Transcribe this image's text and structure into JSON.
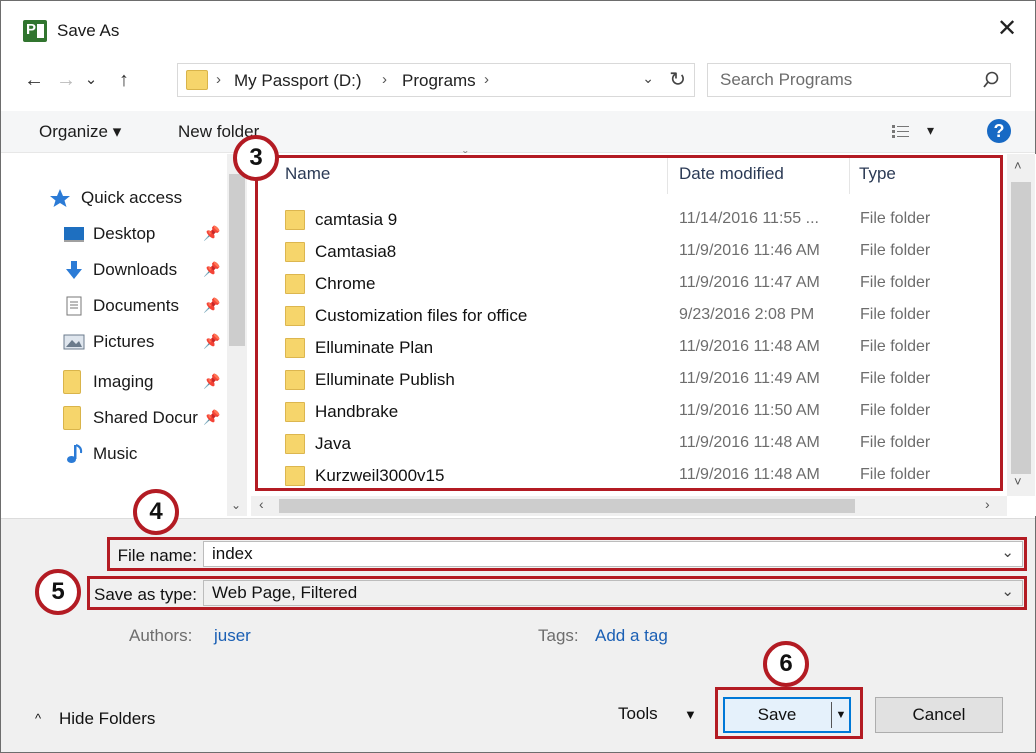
{
  "window": {
    "title": "Save As",
    "app_icon_letter": "P",
    "close_glyph": "✕"
  },
  "nav": {
    "back_glyph": "←",
    "forward_glyph": "→",
    "recent_glyph": "⌄",
    "up_glyph": "↑",
    "breadcrumbs": [
      "My Passport (D:)",
      "Programs"
    ],
    "breadcrumb_sep": "›",
    "dropdown_glyph": "⌄",
    "refresh_glyph": "↻",
    "search_placeholder": "Search Programs"
  },
  "toolbar": {
    "organize_label": "Organize ▾",
    "new_folder_label": "New folder",
    "view_dropdown_glyph": "▾",
    "help_label": "?"
  },
  "navpane": {
    "items": [
      {
        "label": "Quick access",
        "icon": "star-icon",
        "pinned": false
      },
      {
        "label": "Desktop",
        "icon": "desktop-icon",
        "pinned": true
      },
      {
        "label": "Downloads",
        "icon": "download-arrow-icon",
        "pinned": true
      },
      {
        "label": "Documents",
        "icon": "document-icon",
        "pinned": true
      },
      {
        "label": "Pictures",
        "icon": "picture-icon",
        "pinned": true
      },
      {
        "label": "Imaging",
        "icon": "folder-icon",
        "pinned": true
      },
      {
        "label": "Shared Docur",
        "icon": "folder-icon",
        "pinned": true
      },
      {
        "label": "Music",
        "icon": "music-note-icon",
        "pinned": false
      }
    ],
    "pin_glyph": "📌"
  },
  "filelist": {
    "columns": {
      "name": "Name",
      "date": "Date modified",
      "type": "Type"
    },
    "rows": [
      {
        "name": "camtasia 9",
        "date": "11/14/2016 11:55 ...",
        "type": "File folder"
      },
      {
        "name": "Camtasia8",
        "date": "11/9/2016 11:46 AM",
        "type": "File folder"
      },
      {
        "name": "Chrome",
        "date": "11/9/2016 11:47 AM",
        "type": "File folder"
      },
      {
        "name": "Customization files for office",
        "date": "9/23/2016 2:08 PM",
        "type": "File folder"
      },
      {
        "name": "Elluminate Plan",
        "date": "11/9/2016 11:48 AM",
        "type": "File folder"
      },
      {
        "name": "Elluminate Publish",
        "date": "11/9/2016 11:49 AM",
        "type": "File folder"
      },
      {
        "name": "Handbrake",
        "date": "11/9/2016 11:50 AM",
        "type": "File folder"
      },
      {
        "name": "Java",
        "date": "11/9/2016 11:48 AM",
        "type": "File folder"
      },
      {
        "name": "Kurzweil3000v15",
        "date": "11/9/2016 11:48 AM",
        "type": "File folder"
      }
    ]
  },
  "form": {
    "file_name_label": "File name:",
    "file_name_value": "index",
    "save_type_label": "Save as type:",
    "save_type_value": "Web Page, Filtered",
    "authors_label": "Authors:",
    "authors_value": "juser",
    "tags_label": "Tags:",
    "tags_value": "Add a tag"
  },
  "footer": {
    "hide_folders_label": "Hide Folders",
    "tools_label": "Tools",
    "save_label": "Save",
    "cancel_label": "Cancel"
  },
  "annotations": {
    "badge_3": "3",
    "badge_4": "4",
    "badge_5": "5",
    "badge_6": "6",
    "color": "#b31b23"
  }
}
